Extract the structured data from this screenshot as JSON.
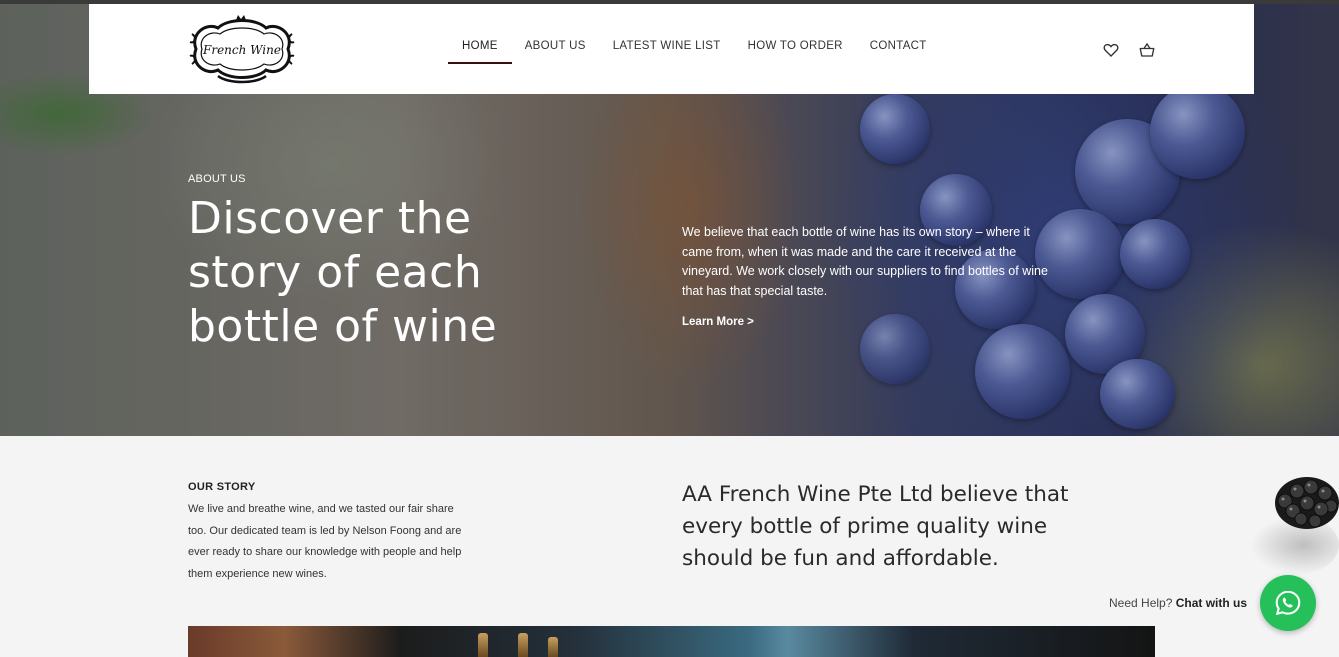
{
  "brand": {
    "logo_text": "French Wine"
  },
  "nav": {
    "items": [
      {
        "label": "HOME",
        "active": true
      },
      {
        "label": "ABOUT US",
        "active": false
      },
      {
        "label": "LATEST WINE LIST",
        "active": false
      },
      {
        "label": "HOW TO ORDER",
        "active": false
      },
      {
        "label": "CONTACT",
        "active": false
      }
    ],
    "icons": [
      "heart-icon",
      "basket-icon"
    ]
  },
  "hero": {
    "overline": "ABOUT US",
    "title": "Discover the story of each bottle of wine",
    "text": "We believe that each bottle of wine has its own story – where it came from, when it was made and the care it received at the vineyard. We work closely with our suppliers to find bottles of wine that has that special taste.",
    "link": "Learn More >"
  },
  "story": {
    "heading": "OUR STORY",
    "text": "We live and breathe wine, and we tasted our fair share too. Our dedicated team is led by Nelson Foong and are ever ready to share our knowledge with people and help them experience new wines.",
    "quote": "AA French Wine Pte Ltd believe that every bottle of prime quality wine should be fun and affordable."
  },
  "chat": {
    "prefix": "Need Help?",
    "action": "Chat with us",
    "color": "#26c05a",
    "icon": "whatsapp-icon"
  },
  "colors": {
    "nav_active_underline": "#3a0d0d",
    "header_bg": "#ffffff",
    "page_bg": "#f4f4f4"
  }
}
